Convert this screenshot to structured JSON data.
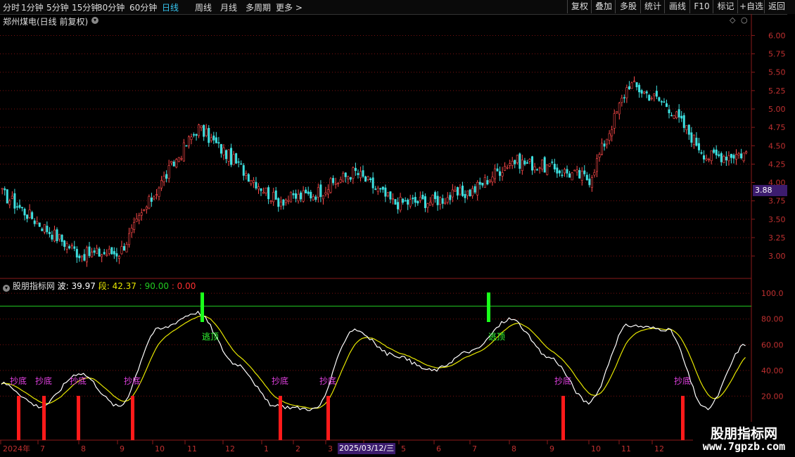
{
  "toolbar": {
    "periods": [
      "分时",
      "1分钟",
      "5分钟",
      "15分钟",
      "30分钟",
      "60分钟",
      "日线",
      "周线",
      "月线",
      "多周期",
      "更多 >"
    ],
    "active_period": "日线",
    "right_buttons": [
      "复权",
      "叠加",
      "多股",
      "统计",
      "画线",
      "F10",
      "标记",
      "+自选",
      "返回"
    ]
  },
  "stock": {
    "title": "郑州煤电(日线 前复权)",
    "last_price": "3.88"
  },
  "indicator": {
    "name": "股朋指标网",
    "wave_label": "波: 39.97",
    "seg_label": "段: 42.37",
    "level_a": ": 90.00",
    "level_b": ": 0.00",
    "buy_text": "抄底",
    "sell_text": "逃顶"
  },
  "x_axis": {
    "labels": [
      "2024年",
      "7",
      "8",
      "9",
      "10",
      "11",
      "12",
      "1",
      "2",
      "3",
      "4",
      "5",
      "6",
      "7",
      "8",
      "9",
      "10",
      "11",
      "12"
    ],
    "cursor_date": "2025/03/12/三"
  },
  "watermark": {
    "title": "股朋指标网",
    "url": "www.7gpzb.com"
  },
  "colors": {
    "up": "#ff4a4a",
    "down": "#3ee0e0",
    "grid": "#7a1010",
    "k_line": "#ffffff",
    "d_line": "#e6e600",
    "buy_bar": "#ff1a1a",
    "sell_bar": "#1aff1a",
    "level_line": "#22cc22",
    "buy_text": "#e040e0",
    "sell_text": "#33ff33"
  },
  "chart_data": [
    {
      "type": "candlestick",
      "title": "郑州煤电(日线 前复权)",
      "y_ticks": [
        "3.00",
        "3.25",
        "3.50",
        "3.75",
        "4.00",
        "4.25",
        "4.50",
        "4.75",
        "5.00",
        "5.25",
        "5.50",
        "5.75",
        "6.00"
      ],
      "ylim": [
        2.8,
        6.1
      ],
      "x": [
        "2024-06",
        "2024-07",
        "2024-08",
        "2024-09",
        "2024-10",
        "2024-11",
        "2024-12",
        "2025-01",
        "2025-02",
        "2025-03",
        "2025-04",
        "2025-05",
        "2025-06",
        "2025-07",
        "2025-08",
        "2025-09",
        "2025-10",
        "2025-11",
        "2025-12",
        "2026-01"
      ],
      "close": [
        3.85,
        3.42,
        3.02,
        3.05,
        3.95,
        4.75,
        4.25,
        3.75,
        3.85,
        4.15,
        3.72,
        3.75,
        3.88,
        4.3,
        4.2,
        4.05,
        5.35,
        5.05,
        4.35,
        4.4
      ],
      "last": 3.88
    },
    {
      "type": "line",
      "title": "股朋指标网",
      "y_ticks": [
        "20.00",
        "40.00",
        "60.00",
        "80.00",
        "100.0"
      ],
      "ylim": [
        0,
        105
      ],
      "level_line": 90,
      "series": [
        {
          "name": "波",
          "last": 39.97
        },
        {
          "name": "段",
          "last": 42.37
        }
      ],
      "x": [
        "2024-06",
        "2024-07",
        "2024-08",
        "2024-09",
        "2024-10",
        "2024-11",
        "2024-12",
        "2025-01",
        "2025-02",
        "2025-03",
        "2025-04",
        "2025-05",
        "2025-06",
        "2025-07",
        "2025-08",
        "2025-09",
        "2025-10",
        "2025-11",
        "2025-12",
        "2026-01"
      ],
      "wave": [
        30,
        12,
        38,
        12,
        72,
        85,
        45,
        12,
        10,
        72,
        52,
        40,
        55,
        80,
        50,
        15,
        75,
        72,
        10,
        60
      ],
      "buy_signals": 9,
      "sell_signals": 2
    }
  ]
}
